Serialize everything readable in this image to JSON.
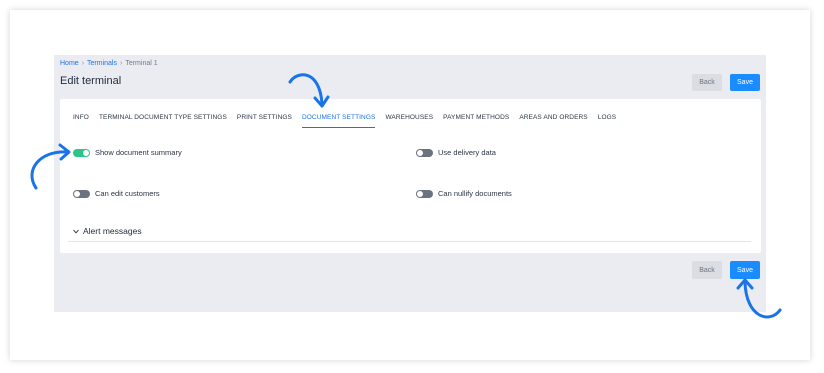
{
  "breadcrumb": {
    "home": "Home",
    "terminals": "Terminals",
    "current": "Terminal 1",
    "separator": "›"
  },
  "page_title": "Edit terminal",
  "buttons": {
    "back": "Back",
    "save": "Save"
  },
  "tabs": [
    {
      "label": "INFO",
      "active": false
    },
    {
      "label": "TERMINAL DOCUMENT TYPE SETTINGS",
      "active": false
    },
    {
      "label": "PRINT SETTINGS",
      "active": false
    },
    {
      "label": "DOCUMENT SETTINGS",
      "active": true
    },
    {
      "label": "WAREHOUSES",
      "active": false
    },
    {
      "label": "PAYMENT METHODS",
      "active": false
    },
    {
      "label": "AREAS AND ORDERS",
      "active": false
    },
    {
      "label": "LOGS",
      "active": false
    }
  ],
  "settings": {
    "show_document_summary": {
      "label": "Show document summary",
      "on": true
    },
    "use_delivery_data": {
      "label": "Use delivery data",
      "on": false
    },
    "can_edit_customers": {
      "label": "Can edit customers",
      "on": false
    },
    "can_nullify_documents": {
      "label": "Can nullify documents",
      "on": false
    }
  },
  "alert_section": {
    "label": "Alert messages",
    "icon": "chevron-down-icon"
  },
  "colors": {
    "accent": "#1a8cff",
    "toggle_on": "#2bc48a",
    "toggle_off": "#6b7280",
    "panel_bg": "#ebecf1"
  }
}
